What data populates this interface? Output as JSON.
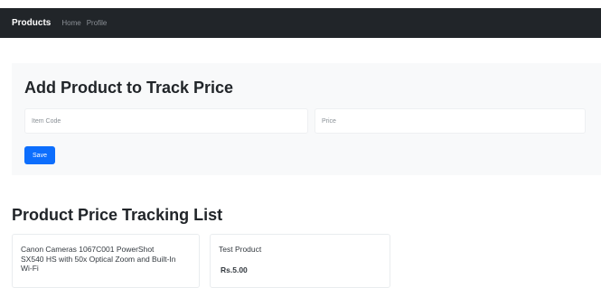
{
  "navbar": {
    "brand": "Products",
    "links": [
      "Home",
      "Profile"
    ]
  },
  "form": {
    "title": "Add Product to Track Price",
    "item_code_placeholder": "Item Code",
    "price_placeholder": "Price",
    "save_label": "Save"
  },
  "list": {
    "title": "Product Price Tracking List",
    "cards": [
      {
        "name": "Canon Cameras 1067C001 PowerShot SX540 HS with 50x Optical Zoom and Built-In Wi-Fi",
        "price": ""
      },
      {
        "name": "Test Product",
        "price": "Rs.5.00"
      }
    ]
  },
  "colors": {
    "navbar_bg": "#212529",
    "primary": "#0d6efd",
    "form_bg": "#f8f9fa"
  }
}
